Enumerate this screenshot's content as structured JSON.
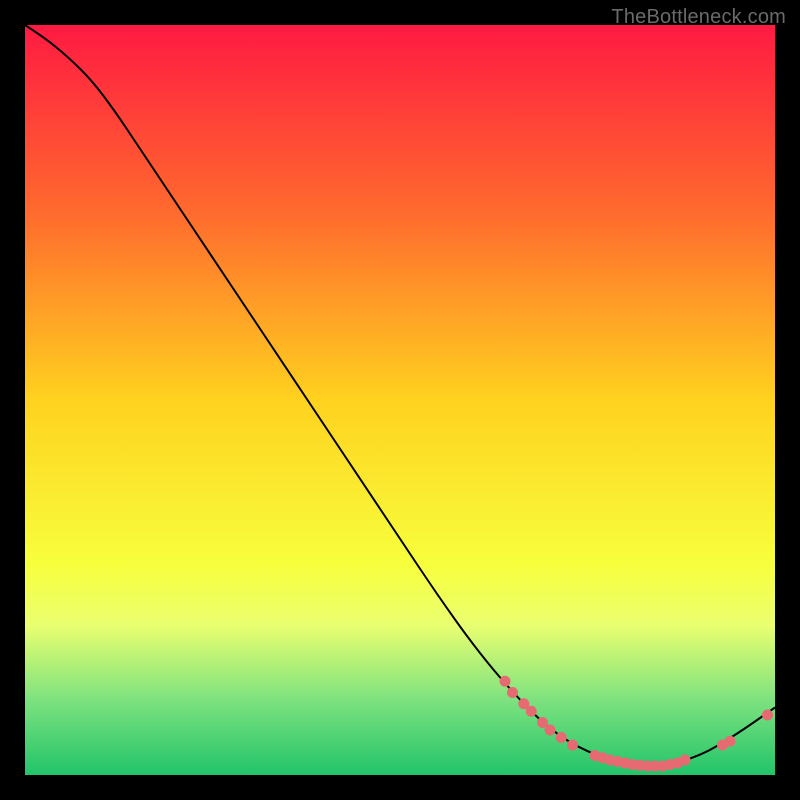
{
  "watermark": "TheBottleneck.com",
  "chart_data": {
    "type": "line",
    "title": "",
    "xlabel": "",
    "ylabel": "",
    "xlim": [
      0,
      100
    ],
    "ylim": [
      0,
      100
    ],
    "background_gradient": {
      "stops": [
        {
          "offset": 0.0,
          "color": "#ff1a42"
        },
        {
          "offset": 0.25,
          "color": "#ff6a2e"
        },
        {
          "offset": 0.5,
          "color": "#ffd21f"
        },
        {
          "offset": 0.72,
          "color": "#f7ff3d"
        },
        {
          "offset": 0.8,
          "color": "#eaff70"
        },
        {
          "offset": 0.9,
          "color": "#7de27f"
        },
        {
          "offset": 1.0,
          "color": "#22c46a"
        }
      ]
    },
    "curve": [
      {
        "x": 0.0,
        "y": 100.0
      },
      {
        "x": 3.0,
        "y": 98.0
      },
      {
        "x": 6.0,
        "y": 95.5
      },
      {
        "x": 9.0,
        "y": 92.5
      },
      {
        "x": 12.0,
        "y": 88.5
      },
      {
        "x": 15.0,
        "y": 84.0
      },
      {
        "x": 20.0,
        "y": 76.5
      },
      {
        "x": 25.0,
        "y": 69.0
      },
      {
        "x": 30.0,
        "y": 61.5
      },
      {
        "x": 35.0,
        "y": 54.0
      },
      {
        "x": 40.0,
        "y": 46.5
      },
      {
        "x": 45.0,
        "y": 39.0
      },
      {
        "x": 50.0,
        "y": 31.5
      },
      {
        "x": 55.0,
        "y": 24.0
      },
      {
        "x": 60.0,
        "y": 17.0
      },
      {
        "x": 65.0,
        "y": 11.0
      },
      {
        "x": 70.0,
        "y": 6.0
      },
      {
        "x": 75.0,
        "y": 3.0
      },
      {
        "x": 80.0,
        "y": 1.5
      },
      {
        "x": 85.0,
        "y": 1.2
      },
      {
        "x": 90.0,
        "y": 2.5
      },
      {
        "x": 95.0,
        "y": 5.5
      },
      {
        "x": 100.0,
        "y": 9.0
      }
    ],
    "highlighted_points": [
      {
        "x": 64.0,
        "y": 12.5
      },
      {
        "x": 65.0,
        "y": 11.0
      },
      {
        "x": 66.5,
        "y": 9.5
      },
      {
        "x": 67.5,
        "y": 8.5
      },
      {
        "x": 69.0,
        "y": 7.0
      },
      {
        "x": 70.0,
        "y": 6.0
      },
      {
        "x": 71.5,
        "y": 5.0
      },
      {
        "x": 73.0,
        "y": 4.0
      },
      {
        "x": 76.0,
        "y": 2.6
      },
      {
        "x": 77.0,
        "y": 2.3
      },
      {
        "x": 78.0,
        "y": 2.0
      },
      {
        "x": 79.0,
        "y": 1.8
      },
      {
        "x": 80.0,
        "y": 1.6
      },
      {
        "x": 81.0,
        "y": 1.4
      },
      {
        "x": 82.0,
        "y": 1.3
      },
      {
        "x": 83.0,
        "y": 1.2
      },
      {
        "x": 84.0,
        "y": 1.2
      },
      {
        "x": 85.0,
        "y": 1.2
      },
      {
        "x": 86.0,
        "y": 1.4
      },
      {
        "x": 87.0,
        "y": 1.6
      },
      {
        "x": 88.0,
        "y": 2.0
      },
      {
        "x": 93.0,
        "y": 4.0
      },
      {
        "x": 94.0,
        "y": 4.5
      },
      {
        "x": 99.0,
        "y": 8.0
      }
    ],
    "tiny_label": {
      "x": 82.5,
      "y": 1.5,
      "text": "",
      "color": "#e06070"
    },
    "point_color": "#e66a72",
    "curve_color": "#000000"
  }
}
